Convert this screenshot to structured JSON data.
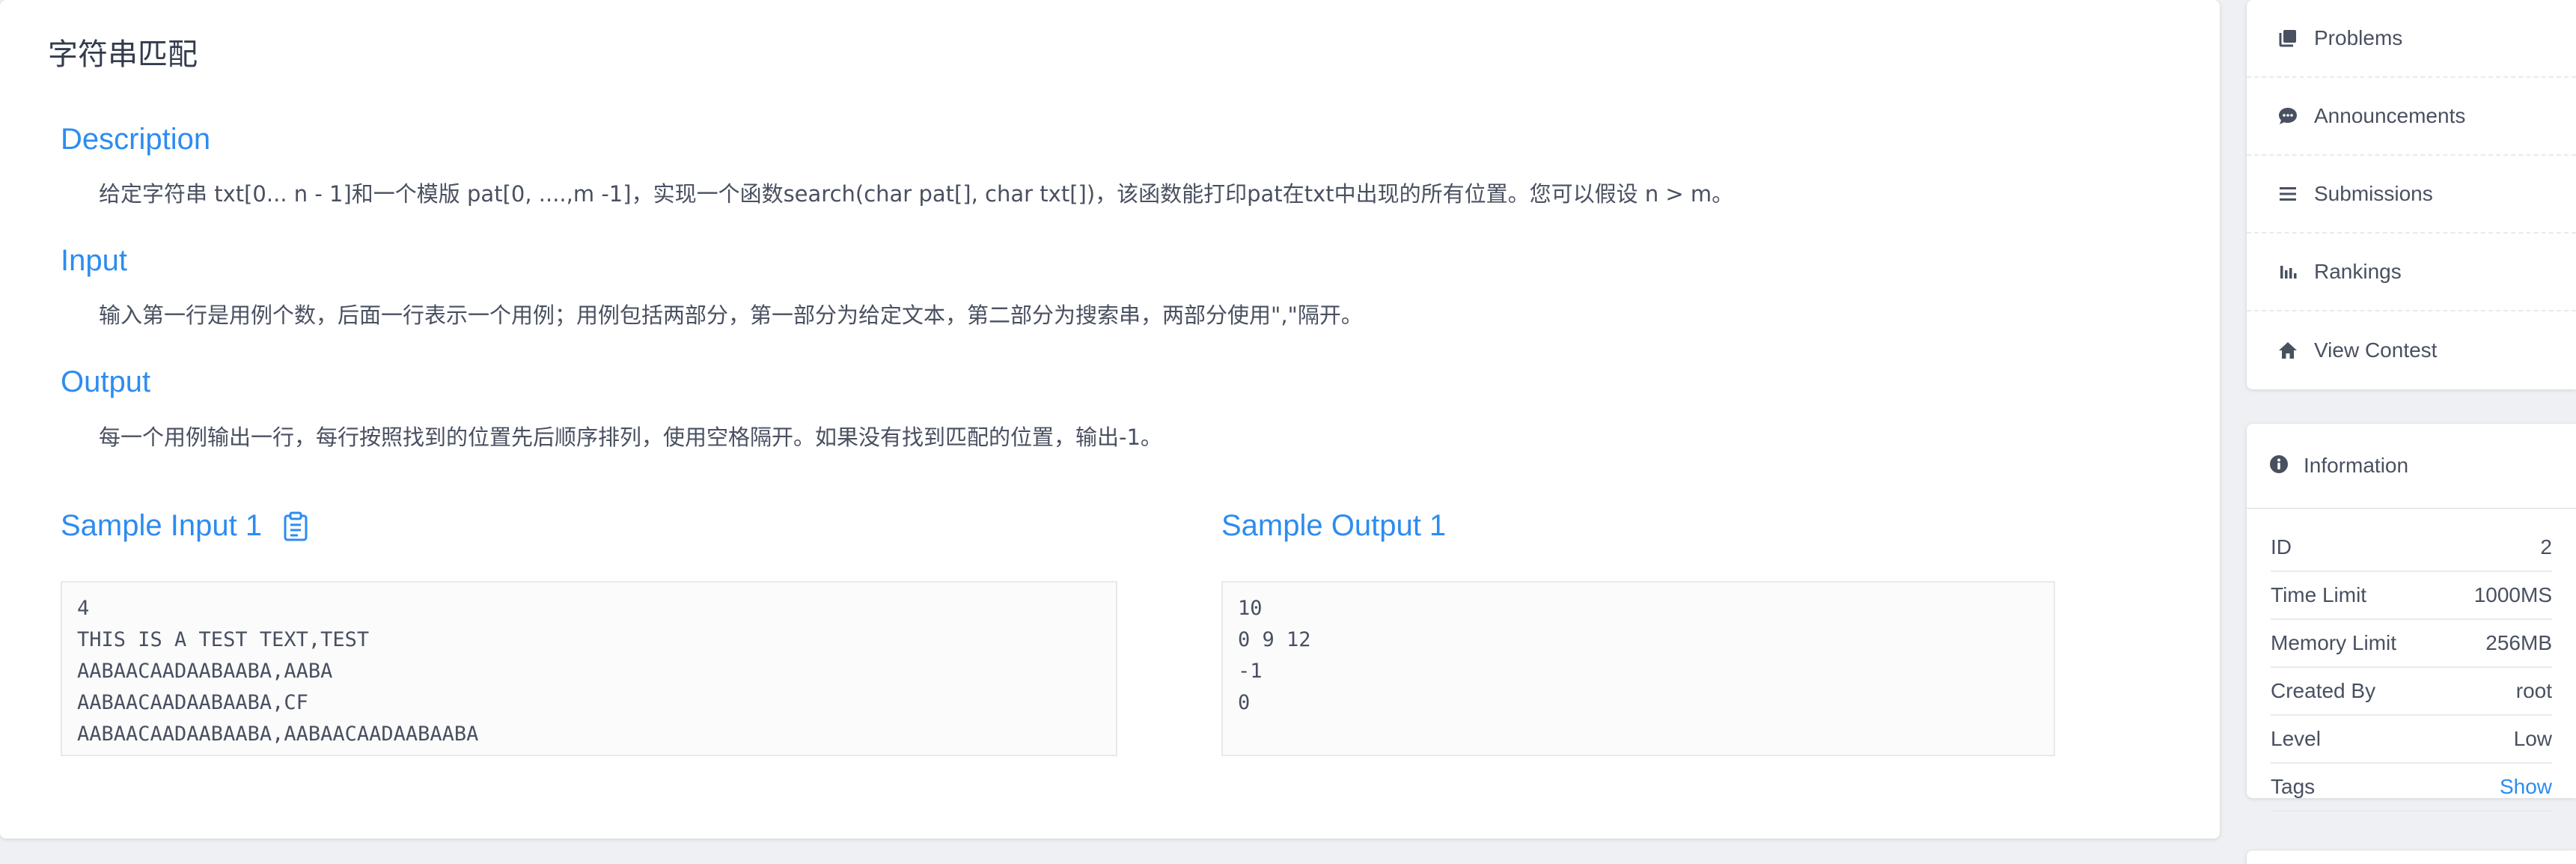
{
  "problem": {
    "title": "字符串匹配",
    "description_heading": "Description",
    "description": "给定字符串 txt[0... n - 1]和一个模版 pat[0, ....,m -1]，实现一个函数search(char pat[], char txt[])，该函数能打印pat在txt中出现的所有位置。您可以假设 n > m。",
    "input_heading": "Input",
    "input": "输入第一行是用例个数，后面一行表示一个用例；用例包括两部分，第一部分为给定文本，第二部分为搜索串，两部分使用\",\"隔开。",
    "output_heading": "Output",
    "output": "每一个用例输出一行，每行按照找到的位置先后顺序排列，使用空格隔开。如果没有找到匹配的位置，输出-1。",
    "sample_input_heading": "Sample Input 1",
    "sample_input": "4\nTHIS IS A TEST TEXT,TEST\nAABAACAADAABAABA,AABA\nAABAACAADAABAABA,CF\nAABAACAADAABAABA,AABAACAADAABAABA",
    "sample_output_heading": "Sample Output 1",
    "sample_output": "10\n0 9 12\n-1\n0"
  },
  "menu": {
    "items": [
      {
        "label": "Problems",
        "icon": "problems-icon"
      },
      {
        "label": "Announcements",
        "icon": "chat-bubble-icon"
      },
      {
        "label": "Submissions",
        "icon": "list-icon"
      },
      {
        "label": "Rankings",
        "icon": "bar-chart-icon"
      },
      {
        "label": "View Contest",
        "icon": "home-icon"
      }
    ]
  },
  "information": {
    "heading": "Information",
    "rows": [
      {
        "label": "ID",
        "value": "2"
      },
      {
        "label": "Time Limit",
        "value": "1000MS"
      },
      {
        "label": "Memory Limit",
        "value": "256MB"
      },
      {
        "label": "Created By",
        "value": "root"
      },
      {
        "label": "Level",
        "value": "Low"
      },
      {
        "label": "Tags",
        "value": "Show"
      }
    ]
  },
  "colors": {
    "accent": "#2d8cf0",
    "text": "#495060",
    "background": "#eef0f3"
  }
}
